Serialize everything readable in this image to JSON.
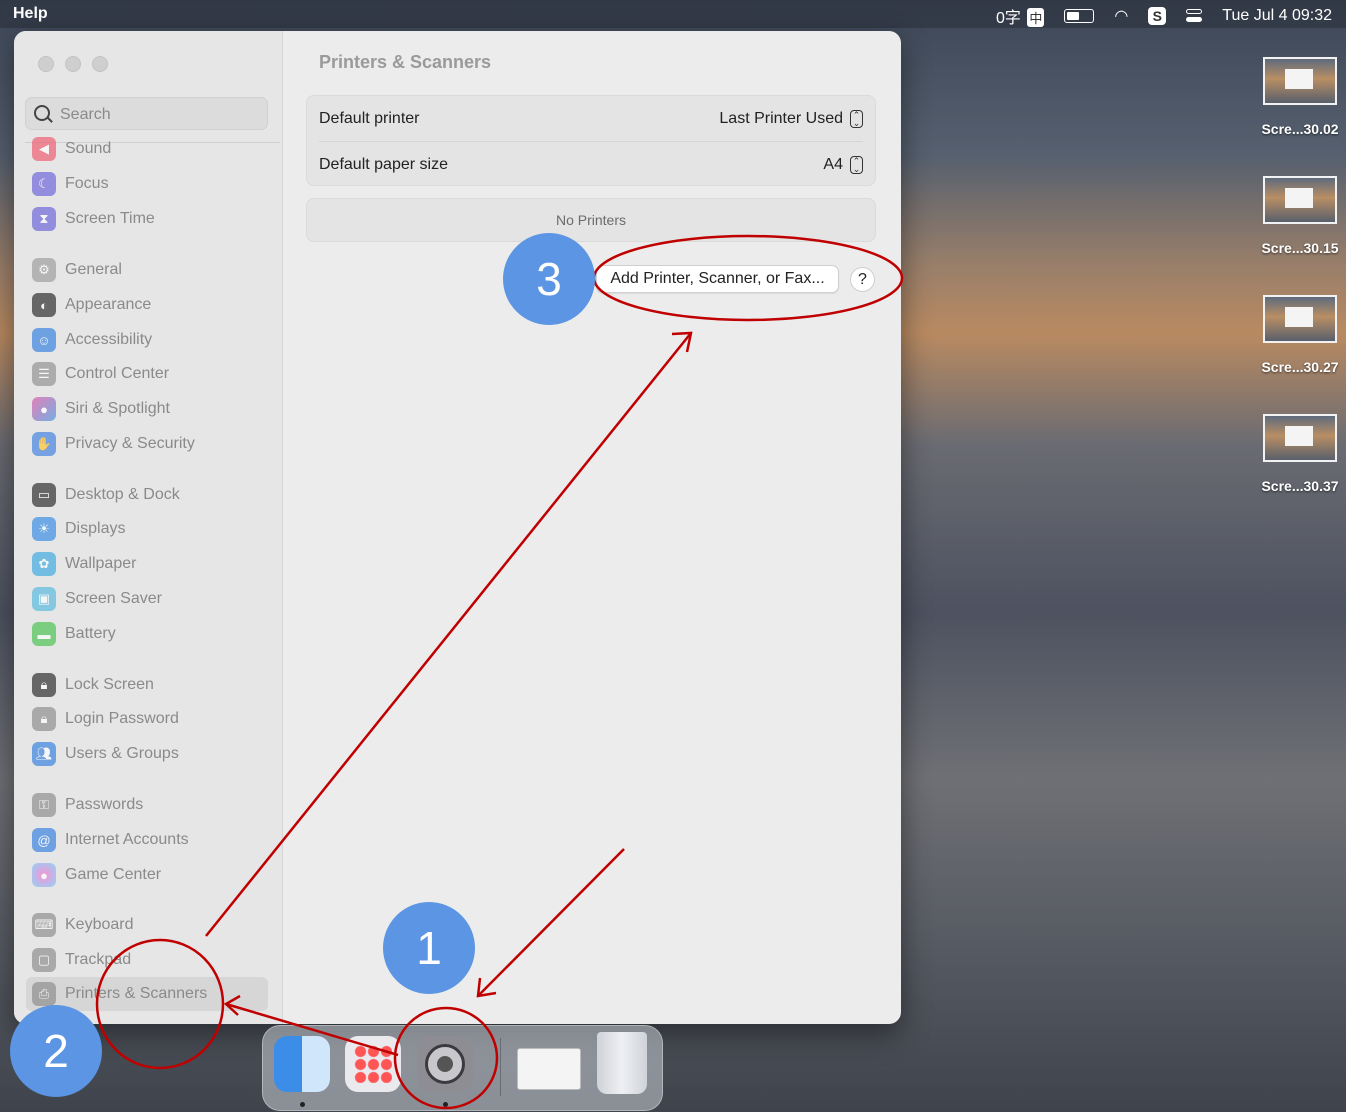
{
  "menubar": {
    "app_menu": "Help",
    "input_method": "0字",
    "ime_char": "中",
    "datetime": "Tue Jul 4  09:32",
    "sogou_char": "S"
  },
  "desktop_files": [
    "Scre...30.02",
    "Scre...30.15",
    "Scre...30.27",
    "Scre...30.37"
  ],
  "sidebar": {
    "search_placeholder": "Search",
    "items": [
      {
        "label": "Sound",
        "icon": "speaker-icon",
        "color": "#f0556a"
      },
      {
        "label": "Focus",
        "icon": "moon-icon",
        "color": "#6660d9"
      },
      {
        "label": "Screen Time",
        "icon": "hourglass-icon",
        "color": "#6660d9"
      },
      {
        "label": "General",
        "icon": "gear-icon",
        "color": "#9a9a9a"
      },
      {
        "label": "Appearance",
        "icon": "appearance-icon",
        "color": "#222222"
      },
      {
        "label": "Accessibility",
        "icon": "accessibility-icon",
        "color": "#2f7de1"
      },
      {
        "label": "Control Center",
        "icon": "toggles-icon",
        "color": "#8e8e8e"
      },
      {
        "label": "Siri & Spotlight",
        "icon": "siri-icon",
        "color": "#7a4fd1"
      },
      {
        "label": "Privacy & Security",
        "icon": "hand-icon",
        "color": "#3a7de0"
      },
      {
        "label": "Desktop & Dock",
        "icon": "dock-icon",
        "color": "#222222"
      },
      {
        "label": "Displays",
        "icon": "sun-icon",
        "color": "#2f8ae6"
      },
      {
        "label": "Wallpaper",
        "icon": "flower-icon",
        "color": "#36a8e0"
      },
      {
        "label": "Screen Saver",
        "icon": "screensaver-icon",
        "color": "#4fb7de"
      },
      {
        "label": "Battery",
        "icon": "battery-icon",
        "color": "#43c04a"
      },
      {
        "label": "Lock Screen",
        "icon": "lock-icon",
        "color": "#222222"
      },
      {
        "label": "Login Password",
        "icon": "lock-icon",
        "color": "#8a8a8a"
      },
      {
        "label": "Users & Groups",
        "icon": "users-icon",
        "color": "#2f7de1"
      },
      {
        "label": "Passwords",
        "icon": "key-icon",
        "color": "#8a8a8a"
      },
      {
        "label": "Internet Accounts",
        "icon": "at-icon",
        "color": "#2f7de1"
      },
      {
        "label": "Game Center",
        "icon": "gamecenter-icon",
        "color": "#e88aa0"
      },
      {
        "label": "Keyboard",
        "icon": "keyboard-icon",
        "color": "#8a8a8a"
      },
      {
        "label": "Trackpad",
        "icon": "trackpad-icon",
        "color": "#8a8a8a"
      },
      {
        "label": "Printers & Scanners",
        "icon": "printer-icon",
        "color": "#8a8a8a"
      }
    ]
  },
  "content": {
    "title": "Printers & Scanners",
    "default_printer_label": "Default printer",
    "default_printer_value": "Last Printer Used",
    "default_paper_label": "Default paper size",
    "default_paper_value": "A4",
    "no_printers": "No Printers",
    "add_button": "Add Printer, Scanner, or Fax...",
    "help_button": "?"
  },
  "dock": [
    {
      "name": "Finder",
      "icon": "finder-icon"
    },
    {
      "name": "Launchpad",
      "icon": "launchpad-icon"
    },
    {
      "name": "System Settings",
      "icon": "settings-icon"
    },
    {
      "name": "Screenshot",
      "icon": "document-icon"
    },
    {
      "name": "Trash",
      "icon": "trash-icon"
    }
  ],
  "annotations": {
    "badge_1": "1",
    "badge_2": "2",
    "badge_3": "3",
    "color": "#c00000"
  }
}
